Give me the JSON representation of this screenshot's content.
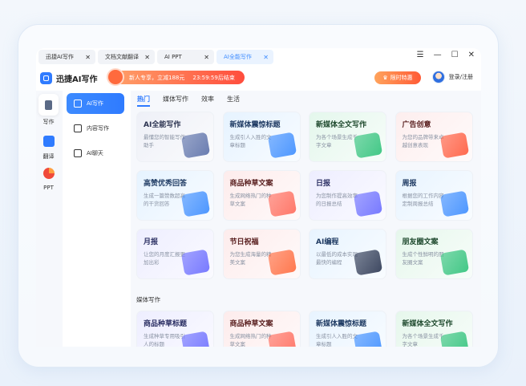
{
  "tabs": [
    {
      "label": "迅捷AI写作"
    },
    {
      "label": "文档文献翻译"
    },
    {
      "label": "AI PPT"
    },
    {
      "label": "AI全能写作"
    }
  ],
  "window_controls": {
    "menu": "☰",
    "minimize": "—",
    "maximize": "☐",
    "close": "✕"
  },
  "header": {
    "app_name": "迅捷AI写作",
    "promo_text": "新人专享，立减188元",
    "promo_timer": "23:59:59后结束",
    "deal_label": "限时特惠",
    "login_label": "登录/注册"
  },
  "rail": [
    {
      "label": "写作"
    },
    {
      "label": "翻译"
    },
    {
      "label": "PPT"
    }
  ],
  "sidebar": [
    {
      "label": "AI写作"
    },
    {
      "label": "内容写作"
    },
    {
      "label": "AI聊天"
    }
  ],
  "content_tabs": [
    {
      "label": "热门"
    },
    {
      "label": "媒体写作"
    },
    {
      "label": "效率"
    },
    {
      "label": "生活"
    }
  ],
  "hot_cards": [
    {
      "title": "AI全能写作",
      "desc": "最懂您的智能写作助手",
      "color": "#2b3350",
      "bg": "#eef0f7",
      "ill": "#5a6fa8"
    },
    {
      "title": "新媒体震惊标题",
      "desc": "生成引人入胜的文章标题",
      "color": "#1f3b63",
      "bg": "#e6f3ff",
      "ill": "#3b8cff"
    },
    {
      "title": "新媒体全文写作",
      "desc": "为各个场景生成千字文章",
      "color": "#1f4a2e",
      "bg": "#e4f7ec",
      "ill": "#2fc27a"
    },
    {
      "title": "广告创意",
      "desc": "为您的品牌带来卓越创意表现",
      "color": "#5a2020",
      "bg": "#fdeeee",
      "ill": "#ff5a3c"
    },
    {
      "title": "高赞优秀回答",
      "desc": "生成一篇赞数超高的干货回答",
      "color": "#1f3b63",
      "bg": "#e6f3ff",
      "ill": "#3b8cff"
    },
    {
      "title": "商品种草文案",
      "desc": "生成网络热门的种草文案",
      "color": "#5a2020",
      "bg": "#fdecec",
      "ill": "#ff6a5a"
    },
    {
      "title": "日报",
      "desc": "为您制作提高效率的日报总结",
      "color": "#2b2f63",
      "bg": "#eeeeff",
      "ill": "#6a6cff"
    },
    {
      "title": "周报",
      "desc": "根据您的工作内容定制周报总结",
      "color": "#1f3b63",
      "bg": "#e8f4ff",
      "ill": "#3b8cff"
    },
    {
      "title": "月报",
      "desc": "让您的月度汇报更加出彩",
      "color": "#2b2f63",
      "bg": "#eeeeff",
      "ill": "#6a6cff"
    },
    {
      "title": "节日祝福",
      "desc": "为您生成海量的精美文案",
      "color": "#5a2020",
      "bg": "#fdecec",
      "ill": "#ff6a3c"
    },
    {
      "title": "AI编程",
      "desc": "以最低的成本实现最快的编程",
      "color": "#1f3b63",
      "bg": "#e8f4ff",
      "ill": "#2a3550"
    },
    {
      "title": "朋友圈文案",
      "desc": "生成个性鲜明的朋友圈文案",
      "color": "#1f4a2e",
      "bg": "#e6f7ec",
      "ill": "#2fc27a"
    }
  ],
  "section_media": "媒体写作",
  "media_cards": [
    {
      "title": "商品种草标题",
      "desc": "生成种草专用吸引人的标题",
      "color": "#2b2f63",
      "bg": "#eeeeff",
      "ill": "#6a6cff"
    },
    {
      "title": "商品种草文案",
      "desc": "生成网络热门的种草文案",
      "color": "#5a2020",
      "bg": "#fdecec",
      "ill": "#ff6a5a"
    },
    {
      "title": "新媒体震惊标题",
      "desc": "生成引人入胜的文章标题",
      "color": "#1f3b63",
      "bg": "#e8f4ff",
      "ill": "#3b8cff"
    },
    {
      "title": "新媒体全文写作",
      "desc": "为各个场景生成千字文章",
      "color": "#1f4a2e",
      "bg": "#e6f7ec",
      "ill": "#2fc27a"
    }
  ]
}
